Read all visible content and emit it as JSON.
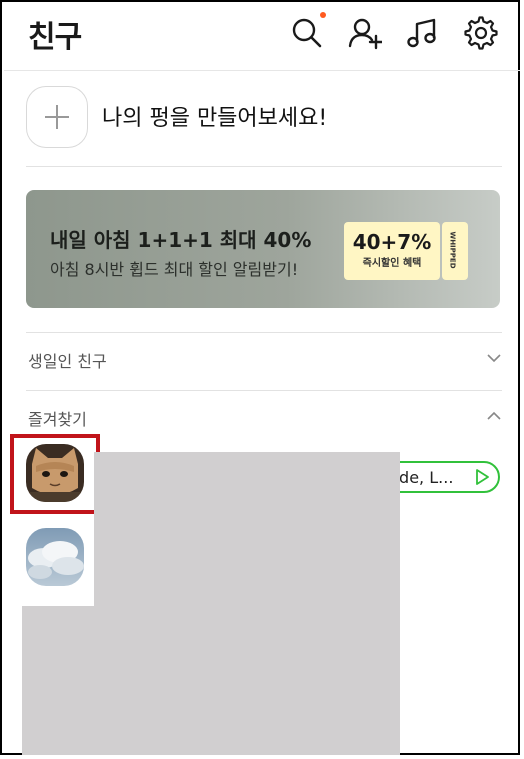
{
  "header": {
    "title": "친구"
  },
  "create_profile": {
    "label": "나의 펑을 만들어보세요!"
  },
  "banner": {
    "title": "내일 아침 1+1+1 최대 40%",
    "subtitle": "아침 8시반 휩드 최대 할인 알림받기!",
    "coupon_main": "40+7%",
    "coupon_sub": "즉시할인 혜택",
    "coupon_brand": "WHIPPED",
    "background_color": "#9ea59c",
    "coupon_color": "#fff6c4"
  },
  "sections": {
    "birthday_label": "생일인 친구",
    "favorites_label": "즐겨찾기"
  },
  "favorites": {
    "music_chip_text": "tside, L...",
    "music_chip_color": "#31c13b"
  },
  "colors": {
    "highlight": "#c1141a",
    "notification_dot": "#ff5a1f"
  }
}
